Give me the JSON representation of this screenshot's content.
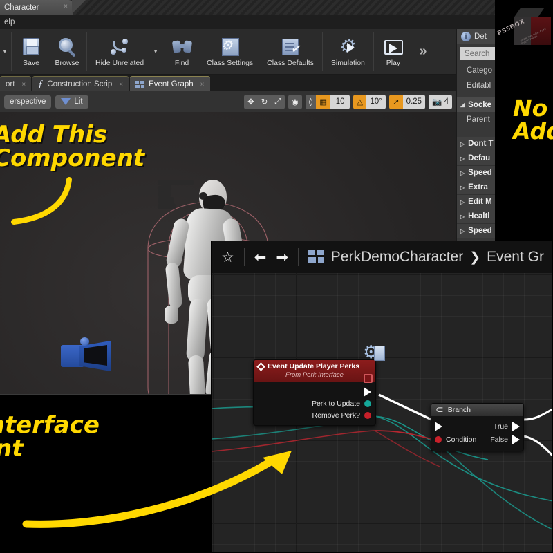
{
  "window": {
    "tab_title": "Character",
    "tab_close": "×",
    "menu_items": [
      "elp"
    ]
  },
  "toolbar": {
    "left_caret": "▼",
    "buttons": [
      {
        "label": "Save",
        "icon": "floppy-disk-icon"
      },
      {
        "label": "Browse",
        "icon": "magnifier-icon"
      },
      {
        "label": "Hide Unrelated",
        "icon": "node-curve-icon"
      },
      {
        "label": "Find",
        "icon": "binoculars-icon"
      },
      {
        "label": "Class Settings",
        "icon": "gear-page-icon"
      },
      {
        "label": "Class Defaults",
        "icon": "checklist-icon"
      },
      {
        "label": "Simulation",
        "icon": "gear-play-icon"
      },
      {
        "label": "Play",
        "icon": "play-monitor-icon"
      }
    ],
    "hide_unrelated_caret": "▼",
    "overflow": "»"
  },
  "editor_tabs": [
    {
      "label": "ort",
      "icon": "viewport-icon",
      "selected": false,
      "close": "×"
    },
    {
      "label": "Construction Scrip",
      "icon": "function-icon",
      "selected": false,
      "close": "×"
    },
    {
      "label": "Event Graph",
      "icon": "graph-squares-icon",
      "selected": true,
      "close": "×"
    }
  ],
  "viewport": {
    "view_mode": "erspective",
    "lit_mode": "Lit",
    "transform_tools": [
      "translate-icon",
      "rotate-icon",
      "scale-icon"
    ],
    "coord_icon": "world-space-icon",
    "surface_snap_icon": "surface-snap-icon",
    "grid_snap": {
      "icon": "grid-snap-icon",
      "value": "10",
      "enabled": true
    },
    "angle_snap": {
      "icon": "angle-snap-icon",
      "value": "10°",
      "enabled": true
    },
    "scale_snap": {
      "icon": "scale-snap-icon",
      "value": "0.25",
      "enabled": true
    },
    "camera_speed": {
      "icon": "camera-speed-icon",
      "value": "4",
      "enabled": false
    }
  },
  "details": {
    "tab_label": "Det",
    "info_glyph": "i",
    "search_placeholder": "Search",
    "rows": [
      "Catego",
      "Editabl"
    ],
    "section": {
      "expander": "◢",
      "label": "Socke"
    },
    "section_rows": [
      "Parent"
    ],
    "categories": [
      {
        "expander": "▷",
        "label": "Dont T"
      },
      {
        "expander": "▷",
        "label": "Defau"
      },
      {
        "expander": "▷",
        "label": "Speed"
      },
      {
        "expander": "▷",
        "label": "Extra"
      },
      {
        "expander": "▷",
        "label": "Edit M"
      },
      {
        "expander": "▷",
        "label": "Healtl"
      },
      {
        "expander": "▷",
        "label": "Speed"
      }
    ]
  },
  "graph": {
    "star_icon": "☆",
    "back_icon": "back-arrow-icon",
    "forward_icon": "forward-arrow-icon",
    "breadcrumb": {
      "blueprint": "PerkDemoCharacter",
      "separator": "❯",
      "graph": "Event Gr"
    },
    "nodes": {
      "event": {
        "title": "Event Update Player Perks",
        "subtitle": "From Perk Interface",
        "pins": [
          {
            "label": "",
            "type": "exec"
          },
          {
            "label": "Perk to Update",
            "type": "object",
            "color": "#15a89a"
          },
          {
            "label": "Remove Perk?",
            "type": "bool",
            "color": "#c7202a"
          }
        ]
      },
      "branch": {
        "title": "Branch",
        "glyph": "⊂",
        "input_exec": "",
        "condition": "Condition",
        "true": "True",
        "false": "False"
      }
    }
  },
  "annotations": {
    "add_component": {
      "line1": "Add This",
      "line2": "Component"
    },
    "interface_event": {
      "line1": "Interface",
      "line2": "ent"
    },
    "now_add": {
      "line1": "No",
      "line2": "Add"
    }
  },
  "branding": {
    "logo_text": "PS5BOX",
    "logo_tagline": "OPEN THE BOX. PLAY EVERYTHING."
  },
  "colors": {
    "accent_orange": "#e8981f",
    "annotation_yellow": "#ffd800",
    "event_node_red": "#8c1c1c",
    "object_pin_teal": "#15a89a",
    "bool_pin_red": "#c7202a"
  }
}
